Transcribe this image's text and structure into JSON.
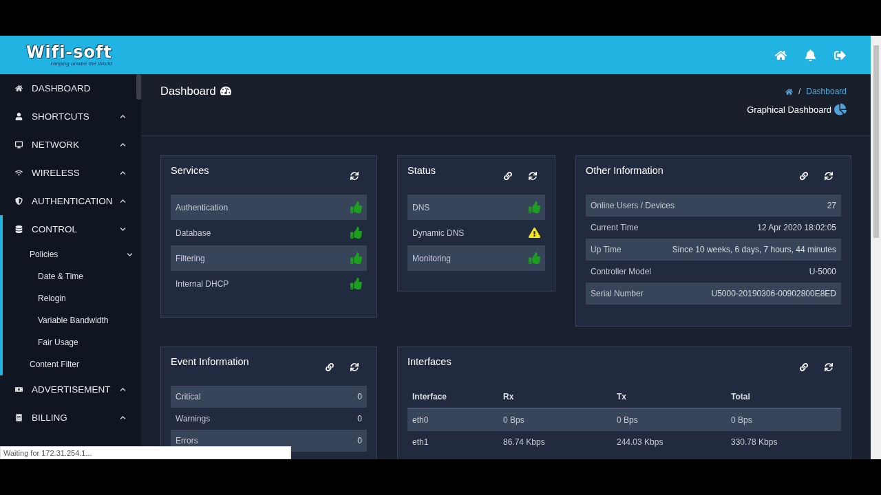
{
  "header": {
    "logo": "Wifi-soft",
    "tagline": "Helping unwire the World"
  },
  "sidebar": {
    "items": [
      {
        "label": "DASHBOARD",
        "selected": false
      },
      {
        "label": "SHORTCUTS",
        "expanded": false,
        "selected": false
      },
      {
        "label": "NETWORK",
        "expanded": false,
        "selected": false
      },
      {
        "label": "WIRELESS",
        "expanded": false,
        "selected": false
      },
      {
        "label": "AUTHENTICATION",
        "expanded": false,
        "selected": false
      },
      {
        "label": "CONTROL",
        "expanded": true,
        "selected": true,
        "children": [
          {
            "label": "Policies",
            "expanded": true,
            "children": [
              {
                "label": "Date & Time"
              },
              {
                "label": "Relogin"
              },
              {
                "label": "Variable Bandwidth"
              },
              {
                "label": "Fair Usage"
              }
            ]
          },
          {
            "label": "Content Filter"
          }
        ]
      },
      {
        "label": "ADVERTISEMENT",
        "expanded": false,
        "selected": false
      },
      {
        "label": "BILLING",
        "expanded": false,
        "selected": false
      }
    ]
  },
  "page": {
    "title": "Dashboard",
    "breadcrumb_separator": "/",
    "breadcrumb": "Dashboard",
    "graphical_link": "Graphical Dashboard"
  },
  "services": {
    "title": "Services",
    "linkable": false,
    "rows": [
      {
        "label": "Authentication",
        "warning": false
      },
      {
        "label": "Database",
        "warning": false
      },
      {
        "label": "Filtering",
        "warning": false
      },
      {
        "label": "Internal DHCP",
        "warning": false
      }
    ]
  },
  "status": {
    "title": "Status",
    "linkable": true,
    "rows": [
      {
        "label": "DNS",
        "warning": false
      },
      {
        "label": "Dynamic DNS",
        "warning": true
      },
      {
        "label": "Monitoring",
        "warning": false
      }
    ]
  },
  "other_information": {
    "title": "Other Information",
    "linkable": true,
    "rows": [
      {
        "label": "Online Users / Devices",
        "value": "27"
      },
      {
        "label": "Current Time",
        "value": "12 Apr 2020 18:02:05"
      },
      {
        "label": "Up Time",
        "value": "Since 10 weeks, 6 days, 7 hours, 44 minutes"
      },
      {
        "label": "Controller Model",
        "value": "U-5000"
      },
      {
        "label": "Serial Number",
        "value": "U5000-20190306-00902800E8ED"
      }
    ]
  },
  "event_information": {
    "title": "Event Information",
    "linkable": true,
    "rows": [
      {
        "label": "Critical",
        "value": "0"
      },
      {
        "label": "Warnings",
        "value": "0"
      },
      {
        "label": "Errors",
        "value": "0"
      }
    ]
  },
  "interfaces": {
    "title": "Interfaces",
    "linkable": true,
    "columns": [
      "Interface",
      "Rx",
      "Tx",
      "Total"
    ],
    "rows": [
      [
        "eth0",
        "0 Bps",
        "0 Bps",
        "0 Bps"
      ],
      [
        "eth1",
        "86.74 Kbps",
        "244.03 Kbps",
        "330.78 Kbps"
      ]
    ]
  },
  "browser_status": "Waiting for 172.31.254.1..."
}
